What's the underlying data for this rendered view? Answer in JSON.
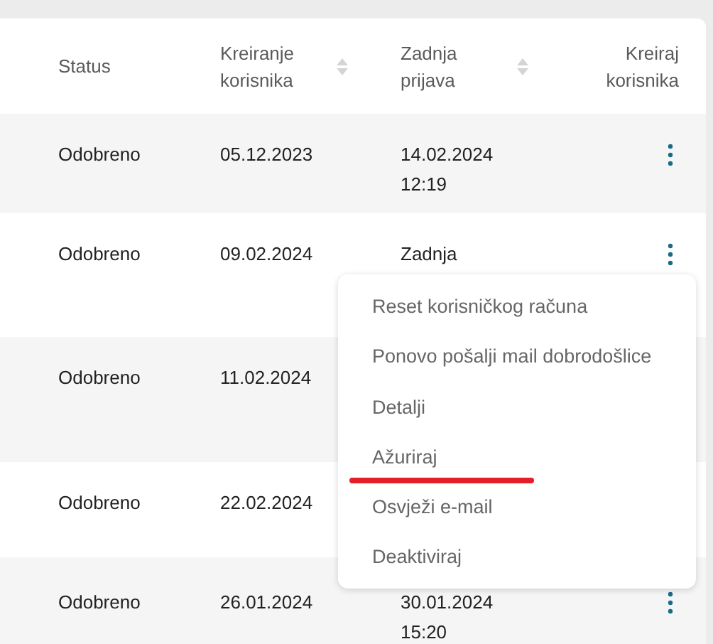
{
  "table": {
    "columns": [
      {
        "label": "Status",
        "sortable": false
      },
      {
        "label": "Kreiranje korisnika",
        "sortable": true
      },
      {
        "label": "Zadnja prijava",
        "sortable": true
      },
      {
        "label": "Kreiraj korisnika",
        "sortable": false
      }
    ],
    "rows": [
      {
        "status": "Odobreno",
        "created": "05.12.2023",
        "last_login": "14.02.2024 12:19"
      },
      {
        "status": "Odobreno",
        "created": "09.02.2024",
        "last_login": "Zadnja"
      },
      {
        "status": "Odobreno",
        "created": "11.02.2024",
        "last_login": ""
      },
      {
        "status": "Odobreno",
        "created": "22.02.2024",
        "last_login": ""
      },
      {
        "status": "Odobreno",
        "created": "26.01.2024",
        "last_login": "30.01.2024 15:20"
      }
    ]
  },
  "context_menu": {
    "items": [
      {
        "label": "Reset korisničkog računa",
        "underlined": false
      },
      {
        "label": "Ponovo pošalji mail dobrodošlice",
        "underlined": false
      },
      {
        "label": "Detalji",
        "underlined": false
      },
      {
        "label": "Ažuriraj",
        "underlined": true
      },
      {
        "label": "Osvježi e-mail",
        "underlined": false
      },
      {
        "label": "Deaktiviraj",
        "underlined": false
      }
    ]
  }
}
